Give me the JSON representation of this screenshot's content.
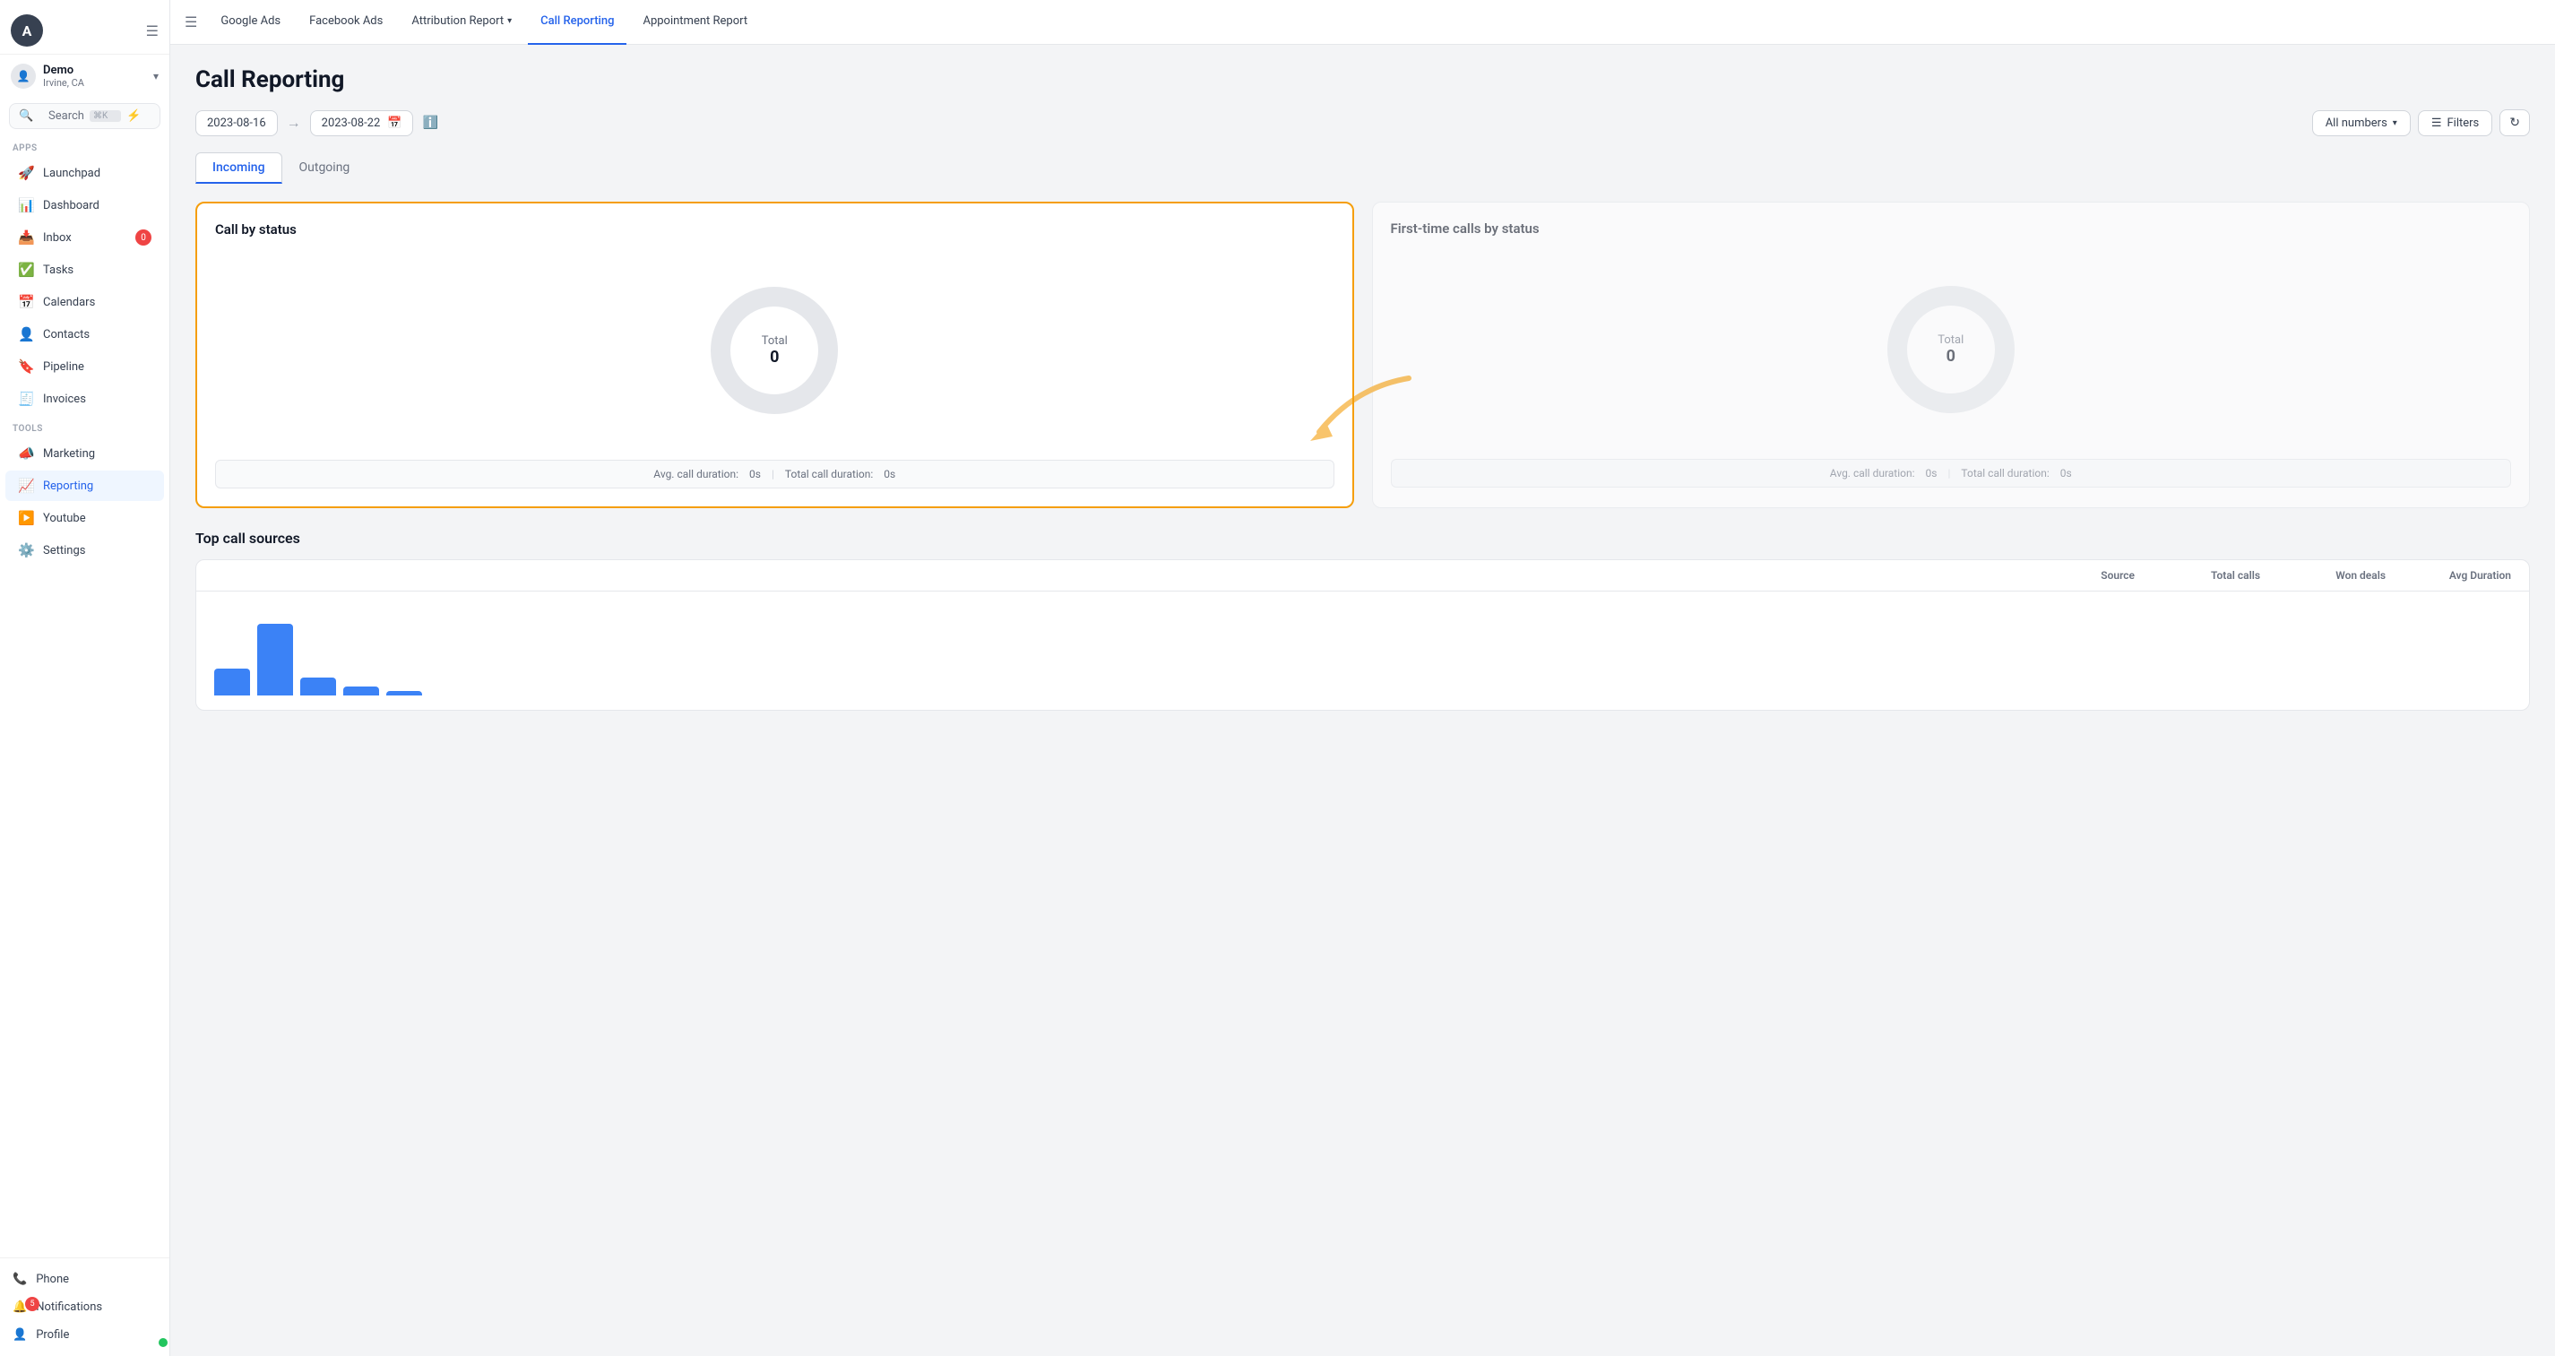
{
  "sidebar": {
    "avatar_letter": "A",
    "account": {
      "name": "Demo",
      "location": "Irvine, CA"
    },
    "search": {
      "label": "Search",
      "shortcut": "⌘K"
    },
    "apps_label": "Apps",
    "apps_items": [
      {
        "id": "launchpad",
        "label": "Launchpad",
        "icon": "🚀"
      },
      {
        "id": "dashboard",
        "label": "Dashboard",
        "icon": "📊"
      },
      {
        "id": "inbox",
        "label": "Inbox",
        "icon": "📥",
        "badge": "0"
      },
      {
        "id": "tasks",
        "label": "Tasks",
        "icon": "✅"
      },
      {
        "id": "calendars",
        "label": "Calendars",
        "icon": "📅"
      },
      {
        "id": "contacts",
        "label": "Contacts",
        "icon": "👤"
      },
      {
        "id": "pipeline",
        "label": "Pipeline",
        "icon": "🔖"
      },
      {
        "id": "invoices",
        "label": "Invoices",
        "icon": "🧾"
      }
    ],
    "tools_label": "Tools",
    "tools_items": [
      {
        "id": "marketing",
        "label": "Marketing",
        "icon": "📣"
      },
      {
        "id": "reporting",
        "label": "Reporting",
        "icon": "📈",
        "active": true
      },
      {
        "id": "youtube",
        "label": "Youtube",
        "icon": "▶️"
      },
      {
        "id": "settings",
        "label": "Settings",
        "icon": "⚙️"
      }
    ],
    "bottom_items": [
      {
        "id": "phone",
        "label": "Phone",
        "icon": "📞"
      },
      {
        "id": "notifications",
        "label": "Notifications",
        "icon": "🔔",
        "badge": "5"
      },
      {
        "id": "profile",
        "label": "Profile",
        "icon": "👤",
        "has_green": true
      }
    ]
  },
  "topnav": {
    "hamburger": "☰",
    "items": [
      {
        "id": "google-ads",
        "label": "Google Ads"
      },
      {
        "id": "facebook-ads",
        "label": "Facebook Ads"
      },
      {
        "id": "attribution-report",
        "label": "Attribution Report",
        "has_chevron": true
      },
      {
        "id": "call-reporting",
        "label": "Call Reporting",
        "active": true
      },
      {
        "id": "appointment-report",
        "label": "Appointment Report"
      }
    ]
  },
  "page": {
    "title": "Call Reporting"
  },
  "toolbar": {
    "date_start": "2023-08-16",
    "date_end": "2023-08-22",
    "all_numbers_label": "All numbers",
    "filters_label": "Filters",
    "refresh_icon": "↻"
  },
  "tabs": [
    {
      "id": "incoming",
      "label": "Incoming",
      "active": true
    },
    {
      "id": "outgoing",
      "label": "Outgoing"
    }
  ],
  "call_by_status": {
    "title": "Call by status",
    "total_label": "Total",
    "total_value": "0",
    "avg_duration_label": "Avg. call duration:",
    "avg_duration_value": "0s",
    "total_duration_label": "Total call duration:",
    "total_duration_value": "0s"
  },
  "first_time_calls": {
    "title": "First-time calls by status",
    "total_label": "Total",
    "total_value": "0",
    "avg_duration_label": "Avg. call duration:",
    "avg_duration_value": "0s",
    "total_duration_label": "Total call duration:",
    "total_duration_value": "0s"
  },
  "top_call_sources": {
    "title": "Top call sources",
    "columns": [
      "Source",
      "Total calls",
      "Won deals",
      "Avg Duration"
    ],
    "bars": [
      30,
      80,
      20,
      10,
      5
    ]
  }
}
